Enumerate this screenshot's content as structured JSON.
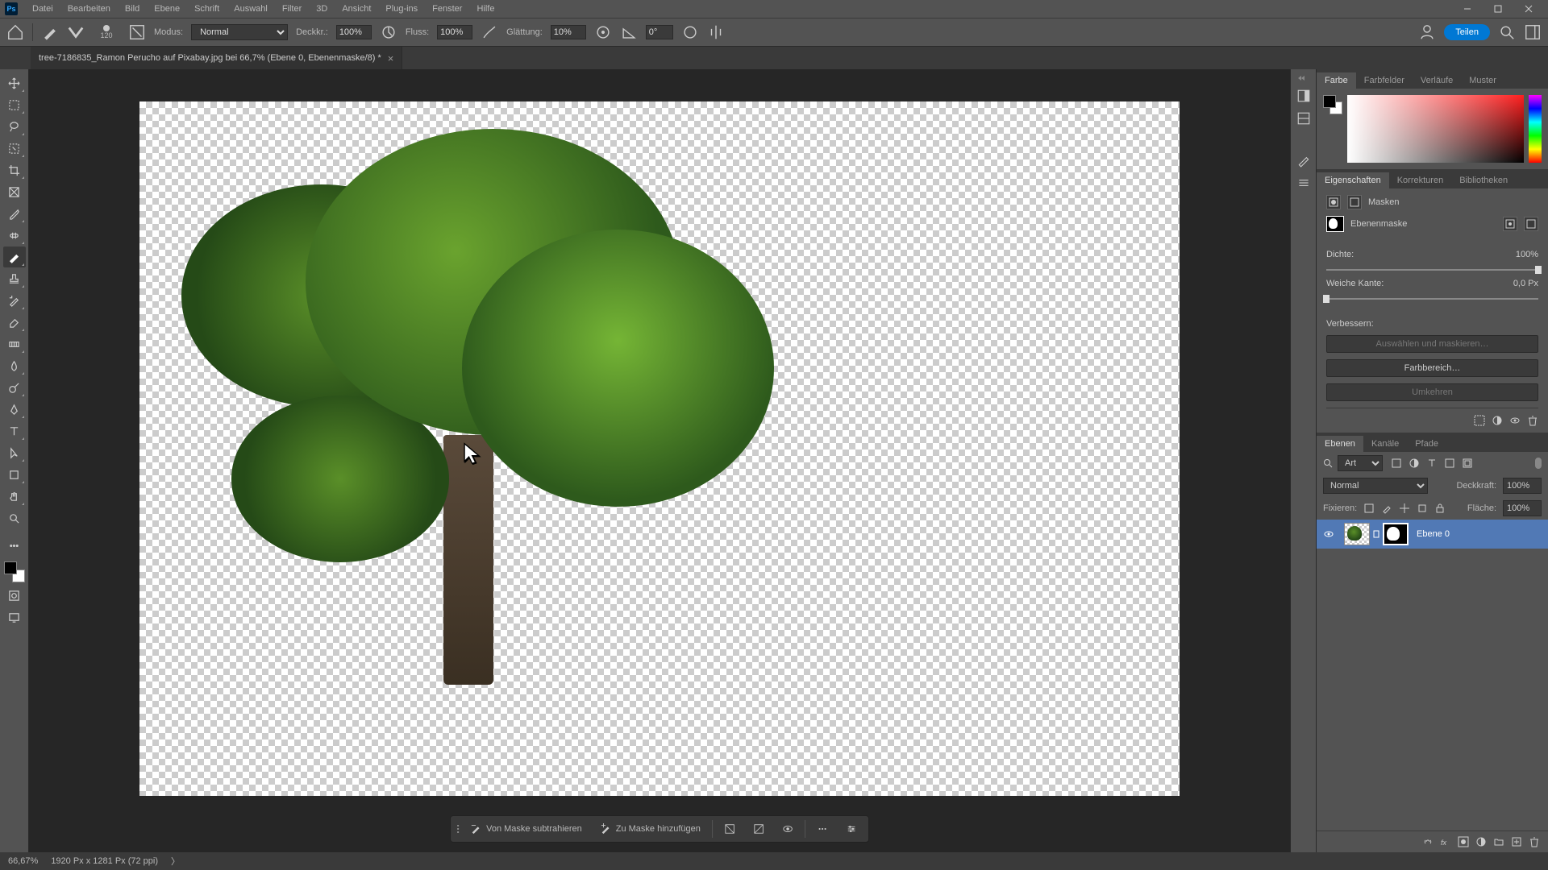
{
  "menubar": {
    "items": [
      "Datei",
      "Bearbeiten",
      "Bild",
      "Ebene",
      "Schrift",
      "Auswahl",
      "Filter",
      "3D",
      "Ansicht",
      "Plug-ins",
      "Fenster",
      "Hilfe"
    ]
  },
  "options": {
    "brush_size": "120",
    "mode_label": "Modus:",
    "mode_value": "Normal",
    "opacity_label": "Deckkr.:",
    "opacity_value": "100%",
    "flow_label": "Fluss:",
    "flow_value": "100%",
    "smoothing_label": "Glättung:",
    "smoothing_value": "10%",
    "angle_value": "0°",
    "share": "Teilen"
  },
  "doc": {
    "title": "tree-7186835_Ramon Perucho auf Pixabay.jpg bei 66,7% (Ebene 0, Ebenenmaske/8) *"
  },
  "context": {
    "subtract": "Von Maske subtrahieren",
    "add": "Zu Maske hinzufügen"
  },
  "panels": {
    "color": {
      "tabs": [
        "Farbe",
        "Farbfelder",
        "Verläufe",
        "Muster"
      ],
      "active": 0
    },
    "props": {
      "tabs": [
        "Eigenschaften",
        "Korrekturen",
        "Bibliotheken"
      ],
      "active": 0,
      "header": "Masken",
      "maskTypeLabel": "Ebenenmaske",
      "density_label": "Dichte:",
      "density_value": "100%",
      "feather_label": "Weiche Kante:",
      "feather_value": "0,0 Px",
      "refine_label": "Verbessern:",
      "select_mask": "Auswählen und maskieren…",
      "color_range": "Farbbereich…",
      "invert": "Umkehren"
    },
    "layers": {
      "tabs": [
        "Ebenen",
        "Kanäle",
        "Pfade"
      ],
      "active": 0,
      "filter_label": "Art",
      "blend_mode": "Normal",
      "opacity_label": "Deckkraft:",
      "opacity_value": "100%",
      "lock_label": "Fixieren:",
      "fill_label": "Fläche:",
      "fill_value": "100%",
      "layer_name": "Ebene 0"
    }
  },
  "status": {
    "zoom": "66,67%",
    "doc_info": "1920 Px x 1281 Px (72 ppi)"
  }
}
